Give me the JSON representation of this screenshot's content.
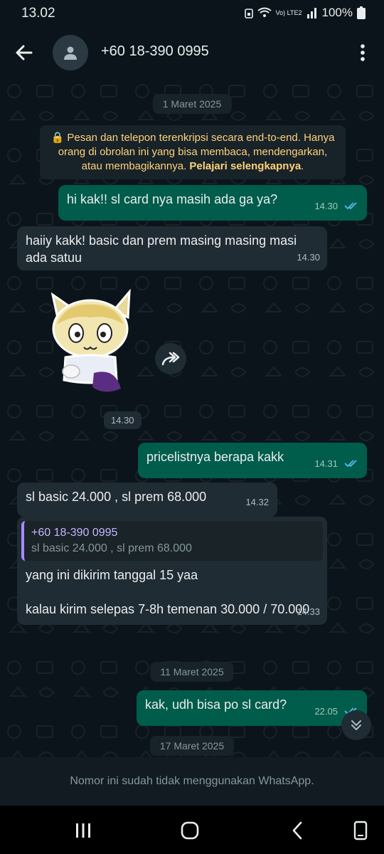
{
  "status_bar": {
    "time": "13.02",
    "battery": "100%",
    "network": "Vo) LTE2"
  },
  "header": {
    "contact_name": "+60 18-390 0995"
  },
  "chat": {
    "date_1": "1 Maret 2025",
    "encryption_notice": "Pesan dan telepon terenkripsi secara end-to-end. Hanya orang di obrolan ini yang bisa membaca, mendengarkan, atau membagikannya.",
    "encryption_link": "Pelajari selengkapnya",
    "messages": [
      {
        "text": "hi kak!! sl card nya masih ada ga ya?",
        "time": "14.30"
      },
      {
        "text": "haiiy kakk! basic dan prem masing masing masi ada satuu",
        "time": "14.30"
      },
      {
        "text": "",
        "time": "14.30"
      },
      {
        "text": "pricelistnya berapa kakk",
        "time": "14.31"
      },
      {
        "text": "sl basic 24.000 , sl prem 68.000",
        "time": "14.32"
      },
      {
        "quote_name": "+60 18-390 0995",
        "quote_text": "sl basic 24.000 , sl prem 68.000",
        "text_1": "yang ini dikirim tanggal 15 yaa",
        "text_2": "kalau kirim selepas 7-8h temenan 30.000 / 70.000",
        "time": "14.33"
      },
      {
        "text": "kak, udh bisa po sl card?",
        "time": "22.05"
      }
    ],
    "date_2": "11 Maret 2025",
    "date_3": "17 Maret 2025"
  },
  "footer": {
    "notice": "Nomor ini sudah tidak menggunakan WhatsApp."
  },
  "colors": {
    "outgoing": "#005c4b",
    "incoming": "#202c33",
    "background": "#0b141a",
    "accent_ticks": "#53bdeb"
  }
}
